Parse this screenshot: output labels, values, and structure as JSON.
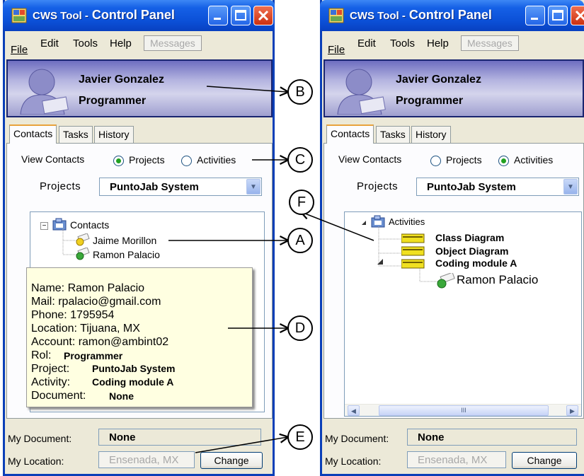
{
  "left": {
    "title_app": "CWS Tool -",
    "title_main": "Control Panel",
    "menu": {
      "file": "File",
      "edit": "Edit",
      "tools": "Tools",
      "help": "Help",
      "messages": "Messages"
    },
    "user": {
      "name": "Javier Gonzalez",
      "role": "Programmer"
    },
    "tabs": [
      "Contacts",
      "Tasks",
      "History"
    ],
    "view_label": "View Contacts",
    "radio_projects": "Projects",
    "radio_activities": "Activities",
    "selected_view": "Projects",
    "projects_label": "Projects",
    "project_value": "PuntoJab System",
    "tree": {
      "root": "Contacts",
      "items": [
        "Jaime Morillon",
        "Ramon Palacio"
      ]
    },
    "tooltip": {
      "name": "Name: Ramon Palacio",
      "mail": "Mail: rpalacio@gmail.com",
      "phone": "Phone: 1795954",
      "location": "Location: Tijuana, MX",
      "account": "Account: ramon@ambint02",
      "rol_label": "Rol:",
      "rol_value": "Programmer",
      "project_label": "Project:",
      "project_value": "PuntoJab System",
      "activity_label": "Activity:",
      "activity_value": "Coding module A",
      "document_label": "Document:",
      "document_value": "None"
    },
    "my_document_label": "My Document:",
    "my_document_value": "None",
    "my_location_label": "My Location:",
    "my_location_value": "Ensenada, MX",
    "change_button": "Change"
  },
  "right": {
    "title_app": "CWS Tool -",
    "title_main": "Control Panel",
    "menu": {
      "file": "File",
      "edit": "Edit",
      "tools": "Tools",
      "help": "Help",
      "messages": "Messages"
    },
    "user": {
      "name": "Javier Gonzalez",
      "role": "Programmer"
    },
    "tabs": [
      "Contacts",
      "Tasks",
      "History"
    ],
    "view_label": "View Contacts",
    "radio_projects": "Projects",
    "radio_activities": "Activities",
    "selected_view": "Activities",
    "projects_label": "Projects",
    "project_value": "PuntoJab System",
    "tree": {
      "root": "Activities",
      "items": [
        "Class Diagram",
        "Object Diagram",
        "Coding module A"
      ],
      "child": "Ramon Palacio"
    },
    "scroll_thumb": "III",
    "my_document_label": "My Document:",
    "my_document_value": "None",
    "my_location_label": "My Location:",
    "my_location_value": "Ensenada, MX",
    "change_button": "Change"
  },
  "callouts": [
    "B",
    "C",
    "A",
    "F",
    "D",
    "E"
  ],
  "colors": {
    "titlebar": "#0b4fd6",
    "window_bg": "#ece9d8",
    "tooltip_bg": "#ffffe1",
    "radio_dot": "#21a121",
    "profile": "#b4b4e0"
  }
}
